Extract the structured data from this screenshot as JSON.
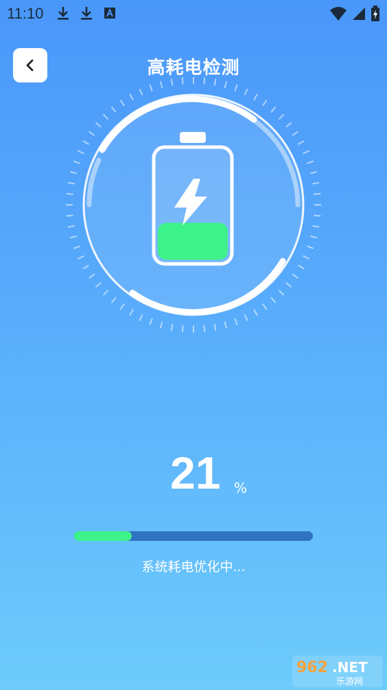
{
  "status_bar": {
    "time": "11:10",
    "left_icons": [
      "download-icon",
      "download-icon",
      "font-icon"
    ],
    "right_icons": [
      "wifi-icon",
      "cell-signal-icon",
      "battery-charging-icon"
    ]
  },
  "header": {
    "back_icon": "chevron-left-icon",
    "title": "高耗电检测"
  },
  "battery": {
    "level_fraction": 0.21,
    "icon": "lightning-icon",
    "fill_color": "#3ef28a"
  },
  "result": {
    "percent_value": "21",
    "percent_unit": "%",
    "progress": 0.24,
    "status_text": "系统耗电优化中..."
  },
  "watermark": {
    "brand": "962.NET",
    "subtitle": "乐游网"
  },
  "colors": {
    "bg_top": "#4a97fa",
    "bg_bottom": "#6dcbfb",
    "accent_green": "#3ef28a",
    "track": "#2f74c0"
  }
}
